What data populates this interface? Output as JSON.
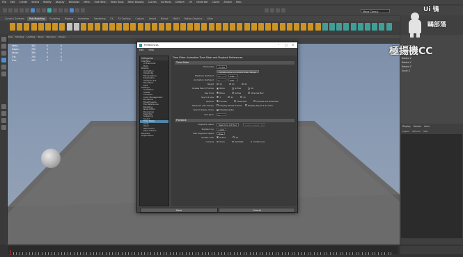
{
  "menubar": [
    "File",
    "Edit",
    "Create",
    "Select",
    "Modify",
    "Display",
    "Windows",
    "Mesh",
    "Edit Mesh",
    "Mesh Tools",
    "Mesh Display",
    "Curves",
    "Surfaces",
    "Deform",
    "UV",
    "Generate",
    "Cache",
    "Arnold",
    "Help"
  ],
  "workspace": {
    "label": "Maya Classic"
  },
  "shelf_tabs": [
    "Curves / Surfaces",
    "Poly Modeling",
    "Sculpting",
    "Rigging",
    "Animation",
    "Rendering",
    "FX",
    "FX Caching",
    "Custom",
    "Arnold",
    "Bifrost",
    "MASH",
    "Motion Graphics",
    "XGen"
  ],
  "viewport": {
    "menus": [
      "View",
      "Shading",
      "Lighting",
      "Show",
      "Renderer",
      "Panels"
    ],
    "stats_labels": [
      "Verts:",
      "Edges:",
      "Faces:",
      "Tris:",
      "UVs:"
    ],
    "stats_values_a": [
      "382",
      "760",
      "380",
      "760",
      "439"
    ],
    "stats_values_b": [
      "0",
      "0",
      "0",
      "0",
      "0"
    ],
    "stats_values_c": [
      "0",
      "0",
      "0",
      "0",
      "0"
    ]
  },
  "channel_box": {
    "rows": [
      "Channels",
      "Edit",
      "Object",
      "Show"
    ],
    "items": [
      "Translate X",
      "Translate Y",
      "Translate Z",
      "Rotate X",
      "Rotate Y",
      "Rotate Z",
      "Scale X"
    ]
  },
  "layer_panel": {
    "tabs": [
      "Display",
      "Render",
      "Anim"
    ],
    "subtabs": [
      "Layers",
      "Options",
      "Help"
    ]
  },
  "dialog": {
    "title": "Preferences",
    "menus": [
      "Edit",
      "Help"
    ],
    "categories_header": "Categories",
    "categories": [
      {
        "label": "Interface",
        "level": 0
      },
      {
        "label": "UI Elements",
        "level": 1
      },
      {
        "label": "Help",
        "level": 1
      },
      {
        "label": "Display",
        "level": 0
      },
      {
        "label": "Animation",
        "level": 1
      },
      {
        "label": "ViewCube",
        "level": 1
      },
      {
        "label": "Manipulators",
        "level": 1
      },
      {
        "label": "Kinematics",
        "level": 1
      },
      {
        "label": "Viewport 2.0",
        "level": 1
      },
      {
        "label": "Transform",
        "level": 1
      },
      {
        "label": "Files",
        "level": 1
      },
      {
        "label": "Settings",
        "level": 0
      },
      {
        "label": "Animation",
        "level": 1
      },
      {
        "label": "Assets",
        "level": 1
      },
      {
        "label": "Cameras",
        "level": 1
      },
      {
        "label": "Color Management",
        "level": 1
      },
      {
        "label": "Dynamics",
        "level": 1
      },
      {
        "label": "Files/Projects",
        "level": 1
      },
      {
        "label": "File References",
        "level": 1
      },
      {
        "label": "Modeling",
        "level": 1
      },
      {
        "label": "Node Editor",
        "level": 1
      },
      {
        "label": "Rendering",
        "level": 1
      },
      {
        "label": "Selection",
        "level": 1
      },
      {
        "label": "Snapping",
        "level": 1
      },
      {
        "label": "Sound",
        "level": 1
      },
      {
        "label": "Time Slider",
        "level": 1,
        "selected": true
      },
      {
        "label": "Undo",
        "level": 1
      },
      {
        "label": "XGen",
        "level": 1
      },
      {
        "label": "GPU Cache",
        "level": 1
      },
      {
        "label": "Save Actions",
        "level": 1
      },
      {
        "label": "Modules",
        "level": 0
      },
      {
        "label": "Applications",
        "level": 0
      }
    ],
    "panel_title": "Time Slider: Animation Time Slider and Playback Preferences",
    "section_timeslider": "Time Slider",
    "rows": [
      {
        "label": "Framerate",
        "value": "24 fps"
      },
      {
        "label": "",
        "value": "Update keys on current time change"
      },
      {
        "label": "Playback start/end",
        "a": "1",
        "b": "120"
      },
      {
        "label": "Animation start/end",
        "a": "1",
        "b": "200"
      },
      {
        "label": "Height",
        "options": [
          "1x",
          "2x",
          "4x"
        ]
      },
      {
        "label": "Grease Pencil Frames",
        "options": [
          "None",
          "Active",
          "All"
        ]
      },
      {
        "label": "Key ticks",
        "options": [
          "None",
          "Active",
          "Channel Box"
        ]
      },
      {
        "label": "Key tick size",
        "options": [
          "1",
          "2x",
          "3x"
        ]
      },
      {
        "label": "Options",
        "options": [
          "Frames",
          "Timecode",
          "Frames and timecode"
        ]
      },
      {
        "label": "Playback rate display",
        "checks": [
          "Display Whole Frames",
          "Display Key Tick as Color"
        ]
      },
      {
        "label": "Speed display mode",
        "check_on": "Displaying fps"
      },
      {
        "label": "Tick Span",
        "a": "0"
      }
    ],
    "section_playback": "Playback",
    "playback_rows": [
      {
        "label": "Playback speed",
        "value": "Real-time [24 fps]",
        "extra": "Custom speed (1x)"
      },
      {
        "label": "Playback by",
        "a": "1.000"
      },
      {
        "label": "Max Playback Speed",
        "value": "Free"
      },
      {
        "label": "Update view",
        "options": [
          "Active",
          "All"
        ]
      },
      {
        "label": "Looping",
        "options": [
          "Once",
          "Oscillate",
          "Continuous"
        ]
      }
    ],
    "buttons": {
      "save": "Save",
      "cancel": "Cancel"
    }
  },
  "watermark": {
    "top": "Ui 鴞",
    "mid": "鷗部落",
    "bottom": "極揚機CC"
  }
}
